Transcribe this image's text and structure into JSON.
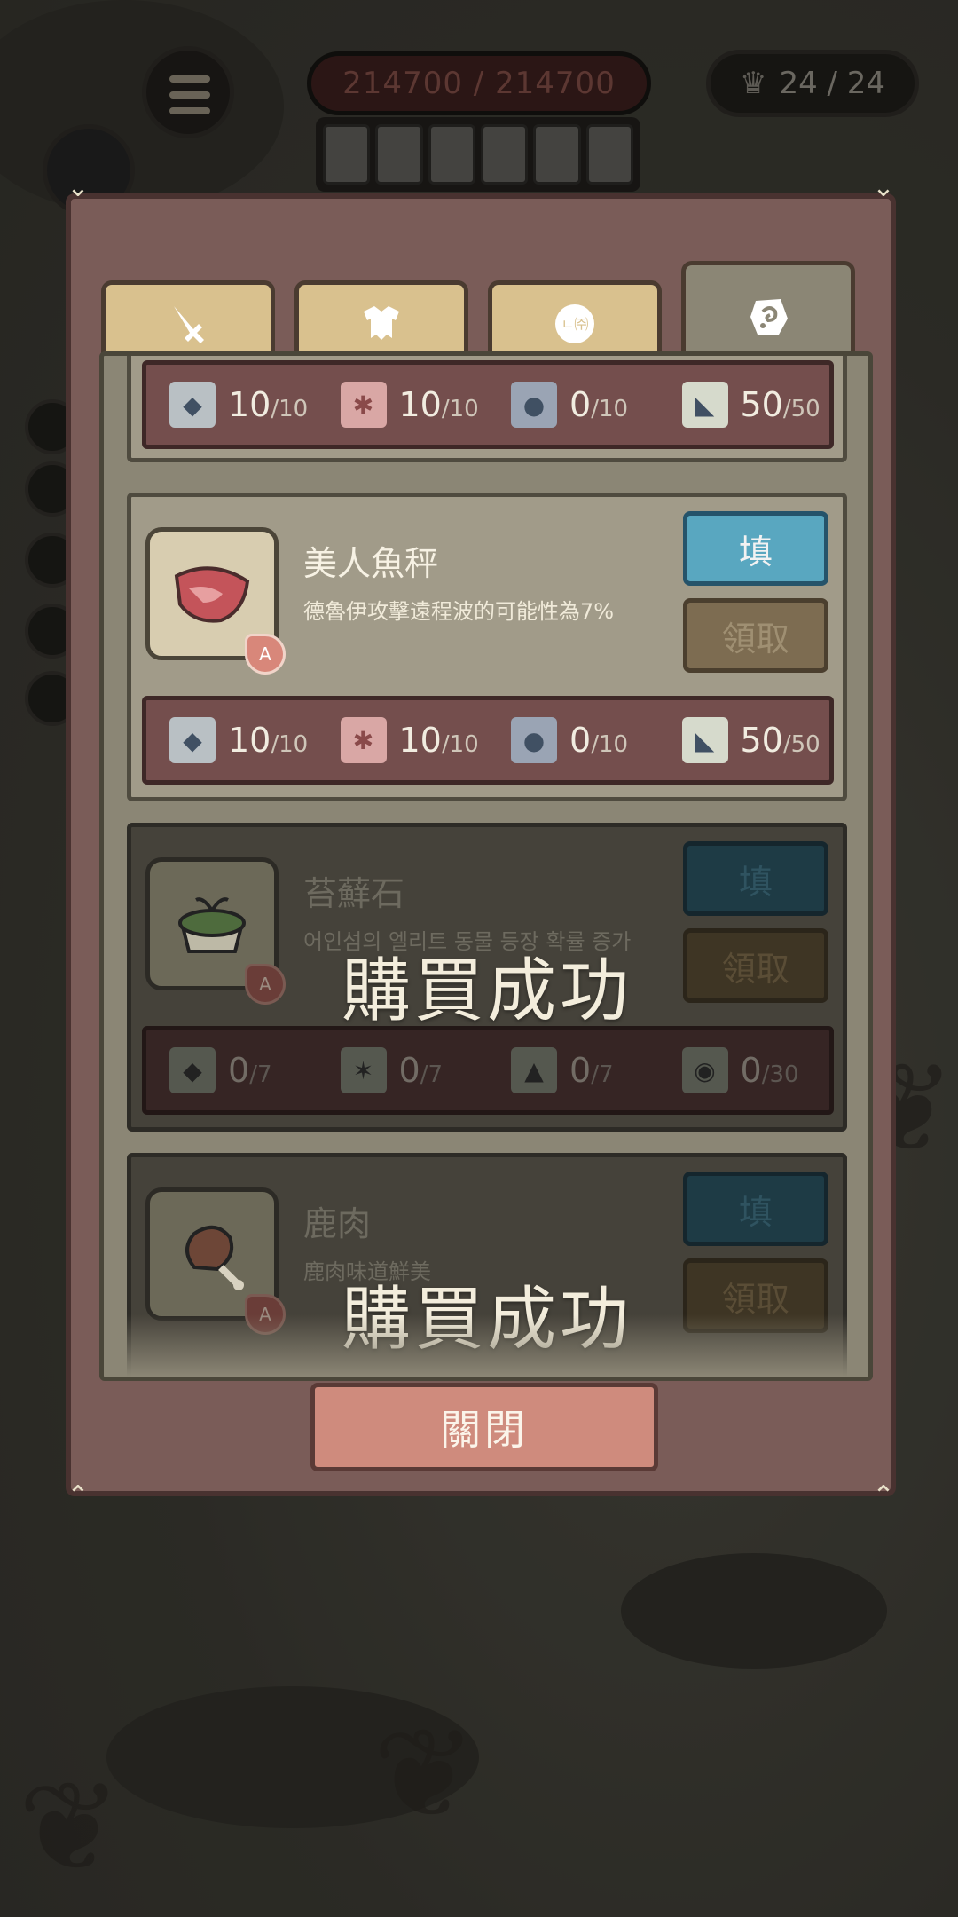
{
  "hud": {
    "hp_text": "214700 / 214700",
    "progress_text": "24 / 24"
  },
  "tabs": [
    {
      "icon": "sword-icon"
    },
    {
      "icon": "armor-icon"
    },
    {
      "icon": "mask-icon"
    },
    {
      "icon": "stone-icon",
      "active": true
    }
  ],
  "items": [
    {
      "mats": [
        {
          "icon": "shark-icon",
          "have": "10",
          "need": "/10"
        },
        {
          "icon": "squid-icon",
          "have": "10",
          "need": "/10"
        },
        {
          "icon": "fish-icon",
          "have": "0",
          "need": "/10"
        },
        {
          "icon": "narwhal-icon",
          "have": "50",
          "need": "/50"
        }
      ]
    },
    {
      "name": "美人魚秤",
      "desc": "德魯伊攻擊遠程波的可能性為7%",
      "grade": "A",
      "fill_label": "填",
      "claim_label": "領取",
      "mats": [
        {
          "icon": "shark-icon",
          "have": "10",
          "need": "/10"
        },
        {
          "icon": "squid-icon",
          "have": "10",
          "need": "/10"
        },
        {
          "icon": "fish-icon",
          "have": "0",
          "need": "/10"
        },
        {
          "icon": "narwhal-icon",
          "have": "50",
          "need": "/50"
        }
      ]
    },
    {
      "name": "苔蘚石",
      "desc": "어인섬의 엘리트 동물 등장 확률 증가",
      "grade": "A",
      "fill_label": "填",
      "claim_label": "領取",
      "mats": [
        {
          "icon": "shark-icon",
          "have": "0",
          "need": "/7"
        },
        {
          "icon": "crab-icon",
          "have": "0",
          "need": "/7"
        },
        {
          "icon": "penguin-icon",
          "have": "0",
          "need": "/7"
        },
        {
          "icon": "turtle-icon",
          "have": "0",
          "need": "/30"
        }
      ]
    },
    {
      "name": "鹿肉",
      "desc": "鹿肉味道鮮美",
      "grade": "A",
      "fill_label": "填",
      "claim_label": "領取"
    }
  ],
  "toast": "購買成功",
  "close_label": "關閉",
  "colors": {
    "dialog": "#7a5c58",
    "panel": "#8b8675",
    "fill_button": "#59a7c0",
    "close_button": "#cf8b7d"
  }
}
